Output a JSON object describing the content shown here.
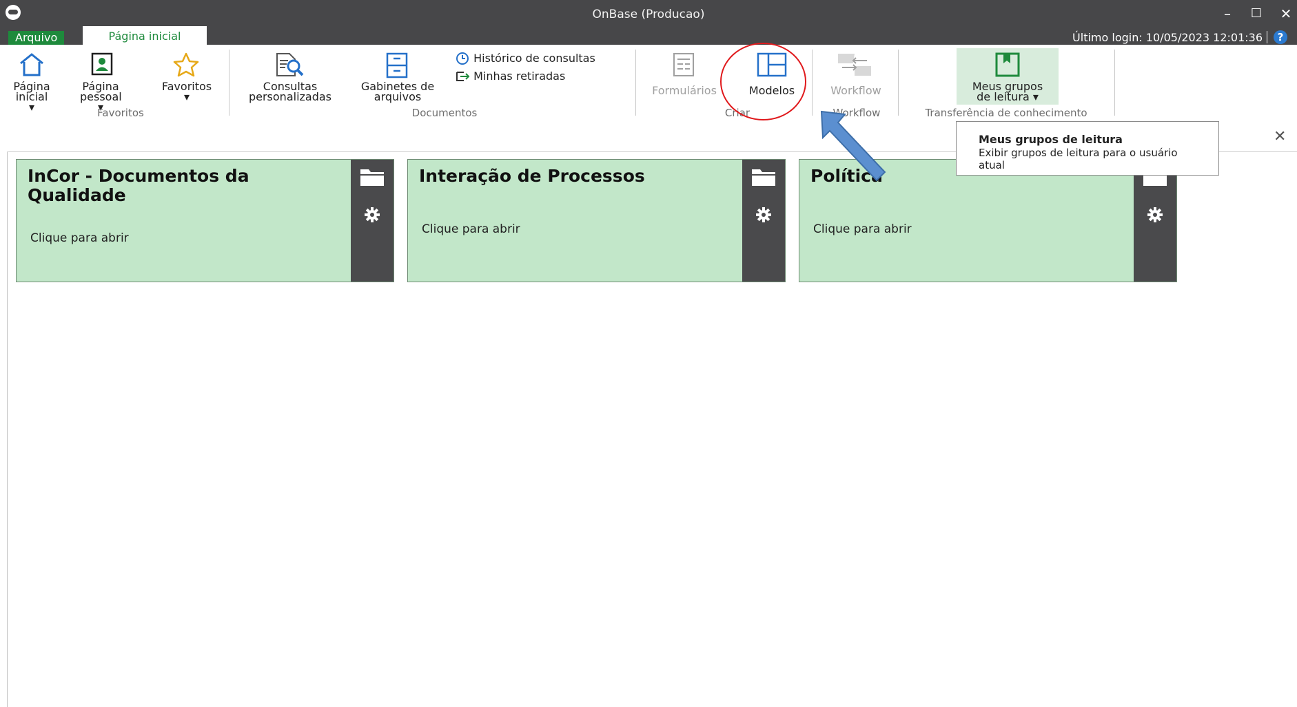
{
  "window": {
    "title": "OnBase (Producao)",
    "controls": [
      "–",
      "☐",
      "✕"
    ]
  },
  "tabs": {
    "file": "Arquivo",
    "home": "Página inicial"
  },
  "last_login": "Último login: 10/05/2023 12:01:36",
  "ribbon": {
    "home_page": [
      "Página",
      "inicial ▾"
    ],
    "personal_page": [
      "Página",
      "pessoal ▾"
    ],
    "favorites": "Favoritos",
    "favorites_arrow": "▾",
    "group_favorites": "Favoritos",
    "custom_queries": [
      "Consultas",
      "personalizadas"
    ],
    "file_cabinets": [
      "Gabinetes de",
      "arquivos"
    ],
    "query_history": "Histórico de consultas",
    "my_checkouts": "Minhas retiradas",
    "group_documents": "Documentos",
    "forms": "Formulários",
    "templates": "Modelos",
    "group_create": "Criar",
    "workflow": "Workflow",
    "group_workflow": "Workflow",
    "reading_groups": [
      "Meus grupos",
      "de leitura ▾"
    ],
    "group_knowledge": "Transferência de conhecimento"
  },
  "tooltip": {
    "title": "Meus grupos de leitura",
    "description": "Exibir grupos de leitura para o usuário atual"
  },
  "search_close": "✕",
  "tiles": [
    {
      "title": "InCor - Documentos da Qualidade",
      "subtitle": "Clique para abrir"
    },
    {
      "title": "Interação de Processos",
      "subtitle": "Clique para abrir"
    },
    {
      "title": "Política",
      "subtitle": "Clique para abrir"
    }
  ],
  "colors": {
    "accent": "#1e8a3c",
    "titlebar": "#474749",
    "tile": "#c2e7c9",
    "annotation_circle": "#e0191c",
    "annotation_arrow": "#5b8fd0"
  }
}
